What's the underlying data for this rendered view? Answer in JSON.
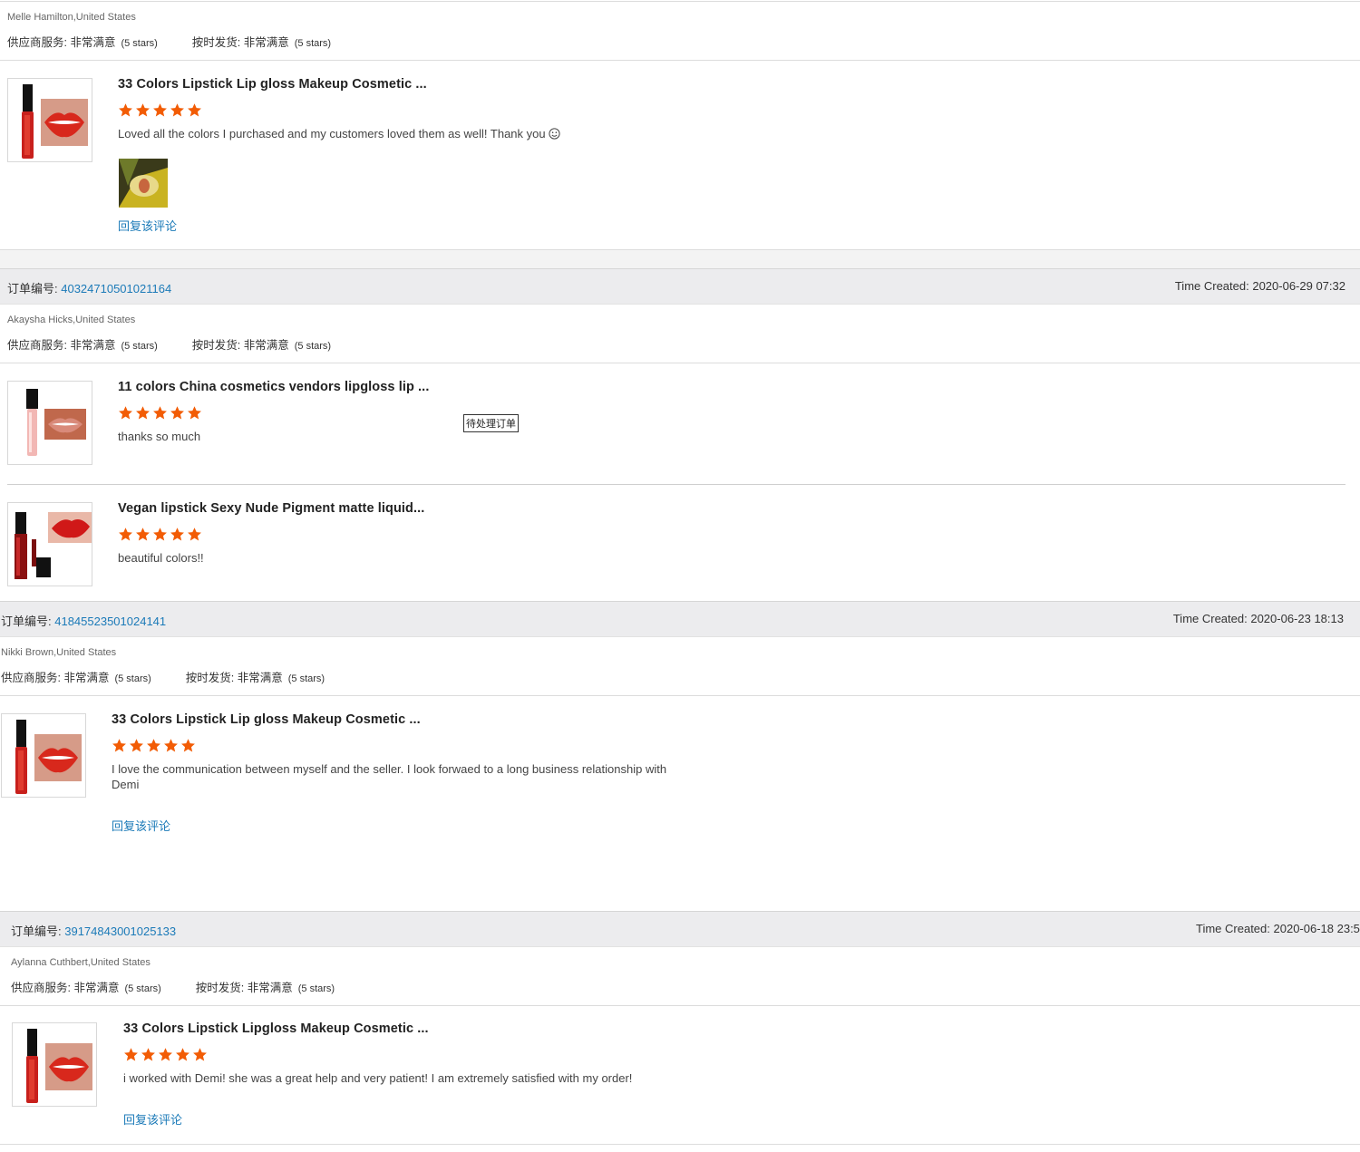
{
  "colors": {
    "accent_link": "#1b7ab8",
    "star": "#f25c05",
    "band_bg": "#ececee"
  },
  "rating_labels": {
    "supplier_service": "供应商服务: 非常满意",
    "on_time_shipment": "按时发货: 非常满意",
    "stars_text": "(5 stars)"
  },
  "reply_label": "回复该评论",
  "order_label": "订单编号: ",
  "time_label": "Time Created: ",
  "first_block": {
    "buyer": "Melle Hamilton,United States",
    "product": {
      "title": "33 Colors Lipstick Lip gloss Makeup Cosmetic ...",
      "rating": 5,
      "comment": "Loved all the colors I purchased and my customers loved them as well! Thank you",
      "emoji_icon": "smiley-icon"
    }
  },
  "orders": [
    {
      "order_number": "40324710501021164",
      "time_created": "2020-06-29 07:32",
      "buyer": "Akaysha Hicks,United States",
      "status_badge": "待处理订单",
      "products": [
        {
          "title": "11 colors China cosmetics vendors lipgloss lip ...",
          "rating": 5,
          "comment": "thanks so much"
        },
        {
          "title": "Vegan lipstick Sexy Nude Pigment matte liquid...",
          "rating": 5,
          "comment": "beautiful colors!!"
        }
      ]
    },
    {
      "order_number": "41845523501024141",
      "time_created": "2020-06-23 18:13",
      "buyer": "Nikki Brown,United States",
      "products": [
        {
          "title": "33 Colors Lipstick Lip gloss Makeup Cosmetic ...",
          "rating": 5,
          "comment": "I love the communication between myself and the seller. I look forwaed to a long business relationship with Demi"
        }
      ]
    },
    {
      "order_number": "39174843001025133",
      "time_created": "2020-06-18 23:5",
      "buyer": "Aylanna Cuthbert,United States",
      "products": [
        {
          "title": "33 Colors Lipstick Lipgloss Makeup Cosmetic ...",
          "rating": 5,
          "comment": "i worked with Demi! she was a great help and very patient! I am extremely satisfied with my order!"
        }
      ]
    }
  ]
}
